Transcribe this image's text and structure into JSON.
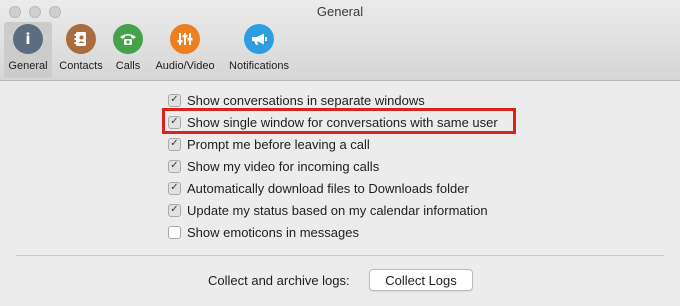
{
  "window": {
    "title": "General"
  },
  "toolbar": {
    "items": [
      {
        "label": "General",
        "icon": "info-icon",
        "glyph": "i",
        "color": "#5b6d80",
        "selected": true
      },
      {
        "label": "Contacts",
        "icon": "contacts-icon",
        "glyph": "▮",
        "color": "#a86c3f",
        "selected": false
      },
      {
        "label": "Calls",
        "icon": "phone-icon",
        "glyph": "☎",
        "color": "#43a24a",
        "selected": false
      },
      {
        "label": "Audio/Video",
        "icon": "sliders-icon",
        "glyph": "⫶",
        "color": "#ee7f1f",
        "selected": false
      },
      {
        "label": "Notifications",
        "icon": "megaphone-icon",
        "glyph": "◀",
        "color": "#2d9ee0",
        "selected": false
      }
    ]
  },
  "options": [
    {
      "label": "Show conversations in separate windows",
      "checked": true
    },
    {
      "label": "Show single window for conversations with same user",
      "checked": true,
      "highlighted": true
    },
    {
      "label": "Prompt me before leaving a call",
      "checked": true
    },
    {
      "label": "Show my video for incoming calls",
      "checked": true
    },
    {
      "label": "Automatically download files to Downloads folder",
      "checked": true
    },
    {
      "label": "Update my status based on my calendar information",
      "checked": true
    },
    {
      "label": "Show emoticons in messages",
      "checked": false
    }
  ],
  "logs": {
    "label": "Collect and archive logs:",
    "button_label": "Collect Logs"
  },
  "colors": {
    "highlight": "#d9261c"
  }
}
